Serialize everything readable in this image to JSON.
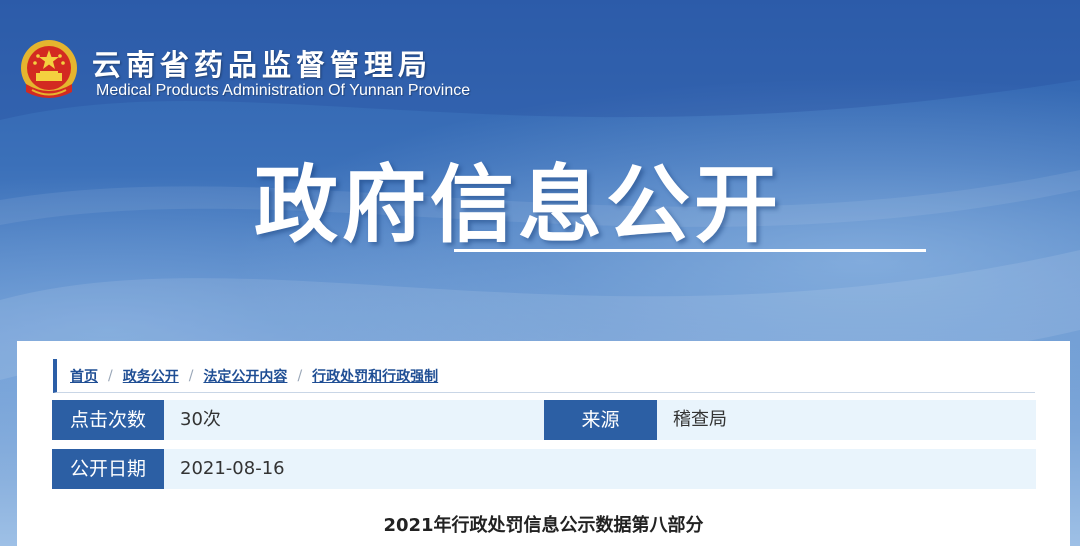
{
  "header": {
    "site_name": "云南省药品监督管理局",
    "site_name_en": "Medical Products Administration Of Yunnan Province",
    "emblem_icon": "national-emblem-icon"
  },
  "banner": {
    "title": "政府信息公开"
  },
  "breadcrumb": {
    "items": [
      "首页",
      "政务公开",
      "法定公开内容",
      "行政处罚和行政强制"
    ],
    "separator": "/"
  },
  "info": {
    "clicks_label": "点击次数",
    "clicks_value": "30次",
    "source_label": "来源",
    "source_value": "稽查局",
    "date_label": "公开日期",
    "date_value": "2021-08-16"
  },
  "article": {
    "title": "2021年行政处罚信息公示数据第八部分"
  },
  "colors": {
    "label_bg": "#2c5fa4",
    "row_bg": "#e9f4fc",
    "crumb_link": "#1f4e94",
    "banner_blue": "#3f72b8"
  }
}
